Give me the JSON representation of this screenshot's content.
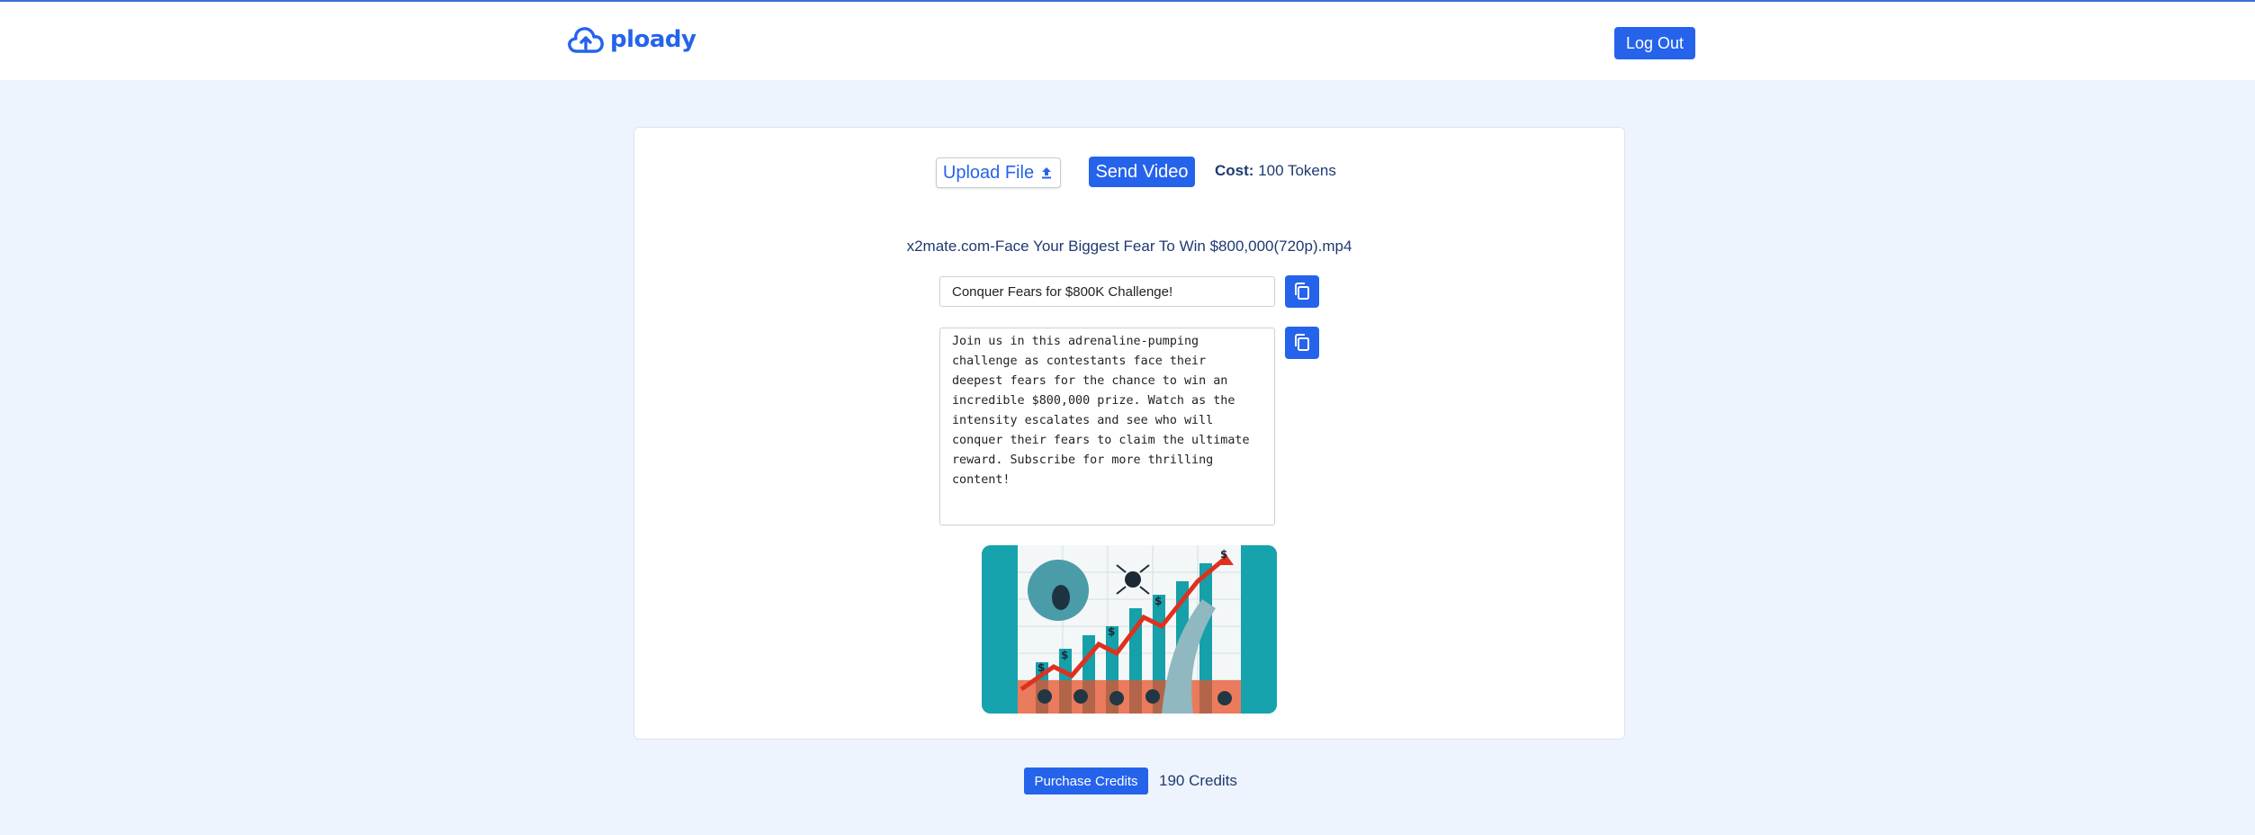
{
  "app": {
    "logo_text": "ploady",
    "logo_icon": "cloud-upload-icon",
    "accent_color": "#2563eb",
    "background_color": "#eef4fd"
  },
  "header": {
    "logout_label": "Log Out"
  },
  "toolbar": {
    "upload_label": "Upload File",
    "upload_icon": "upload-arrow-icon",
    "send_label": "Send Video",
    "cost_label": "Cost:",
    "cost_value": "100 Tokens"
  },
  "video": {
    "filename": "x2mate.com-Face Your Biggest Fear To Win $800,000(720p).mp4",
    "title": "Conquer Fears for $800K Challenge!",
    "description": "Join us in this adrenaline-pumping challenge as contestants face their deepest fears for the chance to win an incredible $800,000 prize. Watch as the intensity escalates and see who will conquer their fears to claim the ultimate reward. Subscribe for more thrilling content!",
    "copy_icon": "copy-icon",
    "thumbnail_alt": "thumbnail-image"
  },
  "footer": {
    "purchase_label": "Purchase Credits",
    "credits_text": "190 Credits"
  }
}
